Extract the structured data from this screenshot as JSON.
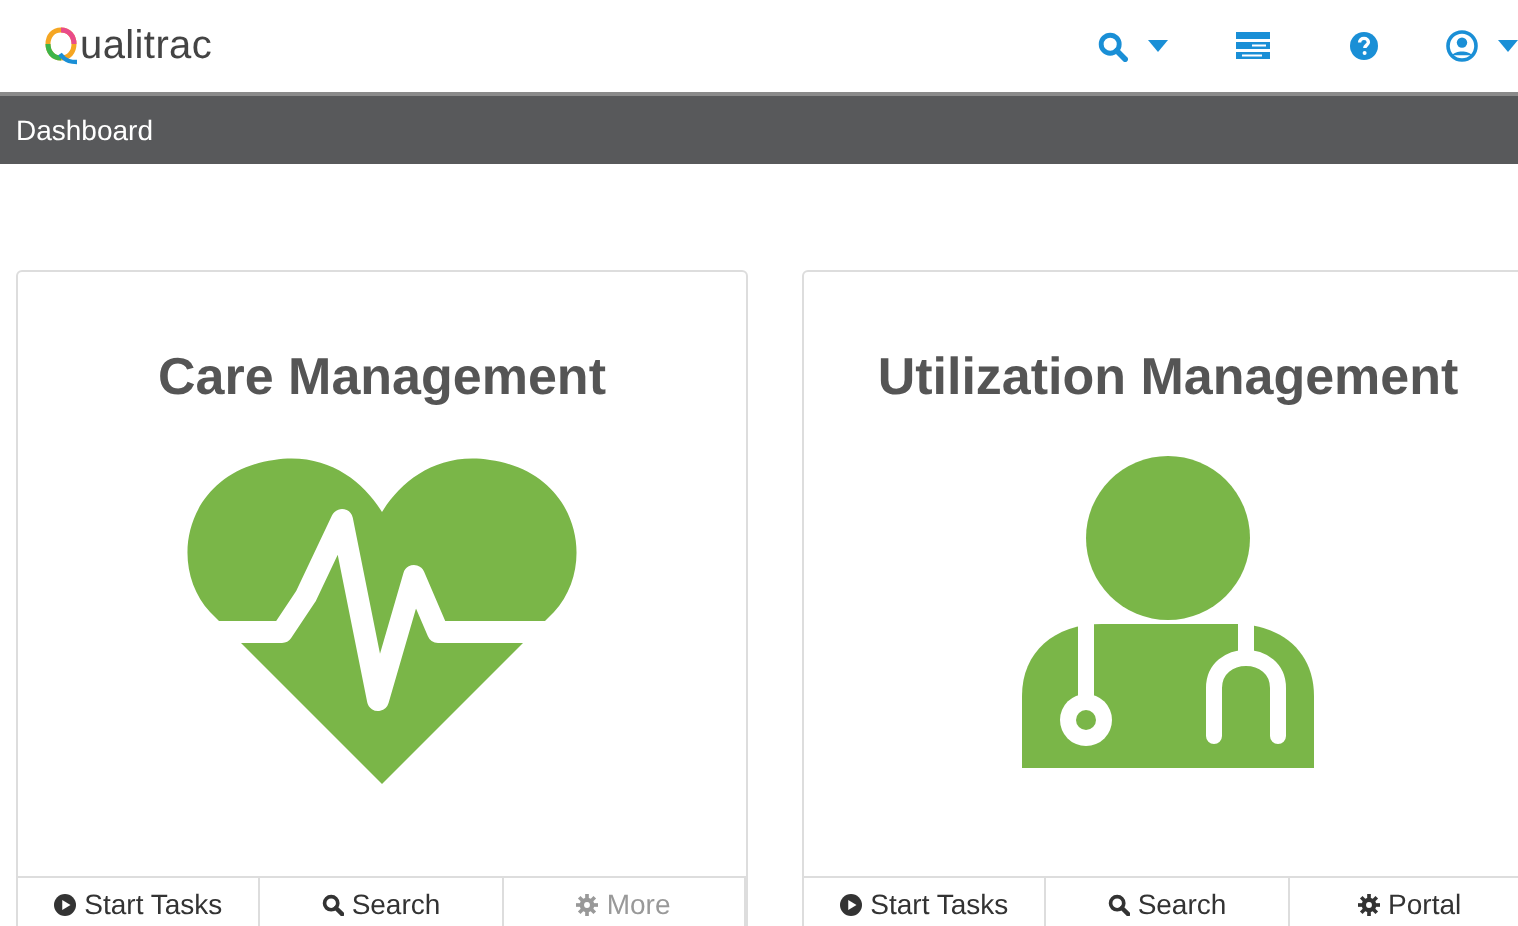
{
  "logo": {
    "text": "ualitrac"
  },
  "breadcrumb": {
    "label": "Dashboard"
  },
  "cards": [
    {
      "title": "Care Management",
      "kind": "heart",
      "buttons": [
        {
          "label": "Start Tasks",
          "kind": "play",
          "disabled": false
        },
        {
          "label": "Search",
          "kind": "search",
          "disabled": false
        },
        {
          "label": "More",
          "kind": "gear",
          "disabled": true
        }
      ]
    },
    {
      "title": "Utilization Management",
      "kind": "doctor",
      "buttons": [
        {
          "label": "Start Tasks",
          "kind": "play",
          "disabled": false
        },
        {
          "label": "Search",
          "kind": "search",
          "disabled": false
        },
        {
          "label": "Portal",
          "kind": "gear",
          "disabled": false
        }
      ]
    }
  ]
}
